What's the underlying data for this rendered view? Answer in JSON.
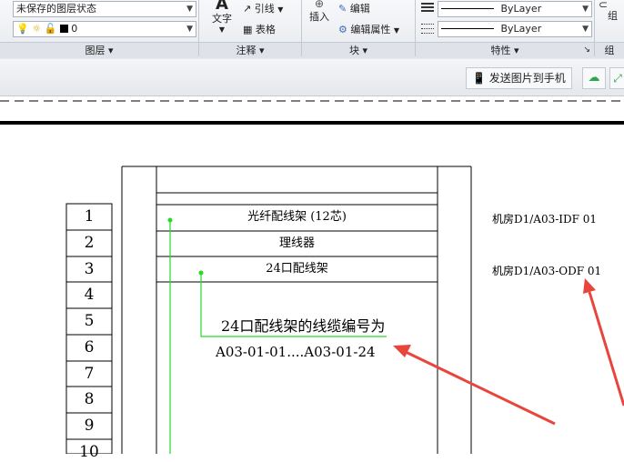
{
  "ribbon": {
    "layer_state": "未保存的图层状态",
    "layer_current": "0",
    "layer_panel": "图层",
    "text_btn": "文字",
    "leader_btn": "引线",
    "table_btn": "表格",
    "annotation_panel": "注释",
    "insert_btn": "插入",
    "edit_btn": "编辑",
    "edit_attr_btn": "编辑属性",
    "block_panel": "块",
    "bylayer_1": "ByLayer",
    "bylayer_2": "ByLayer",
    "properties_panel": "特性",
    "group_label": "组"
  },
  "toolbar": {
    "send_image": "发送图片到手机"
  },
  "drawing": {
    "row_numbers": [
      "1",
      "2",
      "3",
      "4",
      "5",
      "6",
      "7",
      "8",
      "9",
      "10"
    ],
    "rows": [
      "光纤配线架 (12芯)",
      "理线器",
      "24口配线架"
    ],
    "annotation_title": "24口配线架的线缆编号为",
    "annotation_range": "A03-01-01....A03-01-24",
    "right_label_1": "机房D1/A03-IDF 01",
    "right_label_2": "机房D1/A03-ODF 01",
    "colors": {
      "green": "#22dd22",
      "arrow": "#e8453c"
    }
  }
}
